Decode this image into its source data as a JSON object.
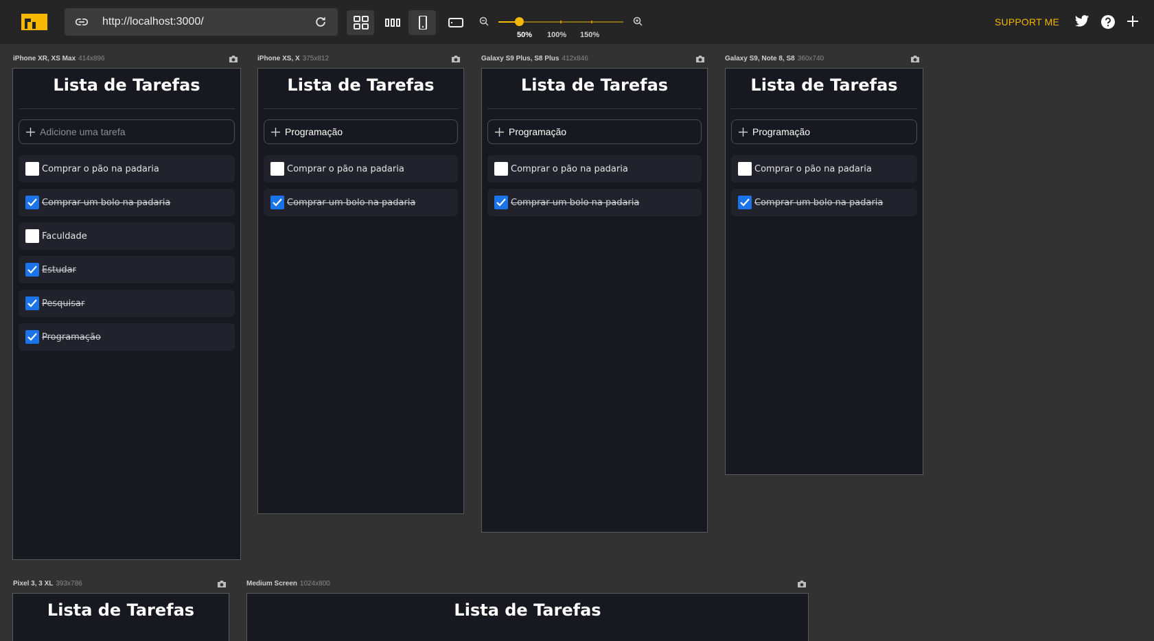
{
  "toolbar": {
    "url": "http://localhost:3000/",
    "zoom_labels": [
      "50%",
      "100%",
      "150%"
    ],
    "zoom_value_percent": 50,
    "support_label": "SUPPORT ME",
    "accent_color": "#f6b800"
  },
  "devices": [
    {
      "name": "iPhone XR, XS Max",
      "resolution": "414x896",
      "app": {
        "title": "Lista de Tarefas",
        "input_value": "",
        "input_placeholder": "Adicione uma tarefa",
        "tasks": [
          {
            "text": "Comprar o pão na padaria",
            "done": false
          },
          {
            "text": "Comprar um bolo na padaria",
            "done": true
          },
          {
            "text": "Faculdade",
            "done": false
          },
          {
            "text": "Estudar",
            "done": true
          },
          {
            "text": "Pesquisar",
            "done": true
          },
          {
            "text": "Programação",
            "done": true
          }
        ]
      }
    },
    {
      "name": "iPhone XS, X",
      "resolution": "375x812",
      "app": {
        "title": "Lista de Tarefas",
        "input_value": "Programação",
        "tasks": [
          {
            "text": "Comprar o pão na padaria",
            "done": false
          },
          {
            "text": "Comprar um bolo na padaria",
            "done": true
          }
        ]
      }
    },
    {
      "name": "Galaxy S9 Plus, S8 Plus",
      "resolution": "412x846",
      "app": {
        "title": "Lista de Tarefas",
        "input_value": "Programação",
        "tasks": [
          {
            "text": "Comprar o pão na padaria",
            "done": false
          },
          {
            "text": "Comprar um bolo na padaria",
            "done": true
          }
        ]
      }
    },
    {
      "name": "Galaxy S9, Note 8, S8",
      "resolution": "360x740",
      "app": {
        "title": "Lista de Tarefas",
        "input_value": "Programação",
        "tasks": [
          {
            "text": "Comprar o pão na padaria",
            "done": false
          },
          {
            "text": "Comprar um bolo na padaria",
            "done": true
          }
        ]
      }
    },
    {
      "name": "Pixel 3, 3 XL",
      "resolution": "393x786",
      "app": {
        "title": "Lista de Tarefas"
      }
    },
    {
      "name": "Medium Screen",
      "resolution": "1024x800",
      "app": {
        "title": "Lista de Tarefas"
      }
    }
  ]
}
